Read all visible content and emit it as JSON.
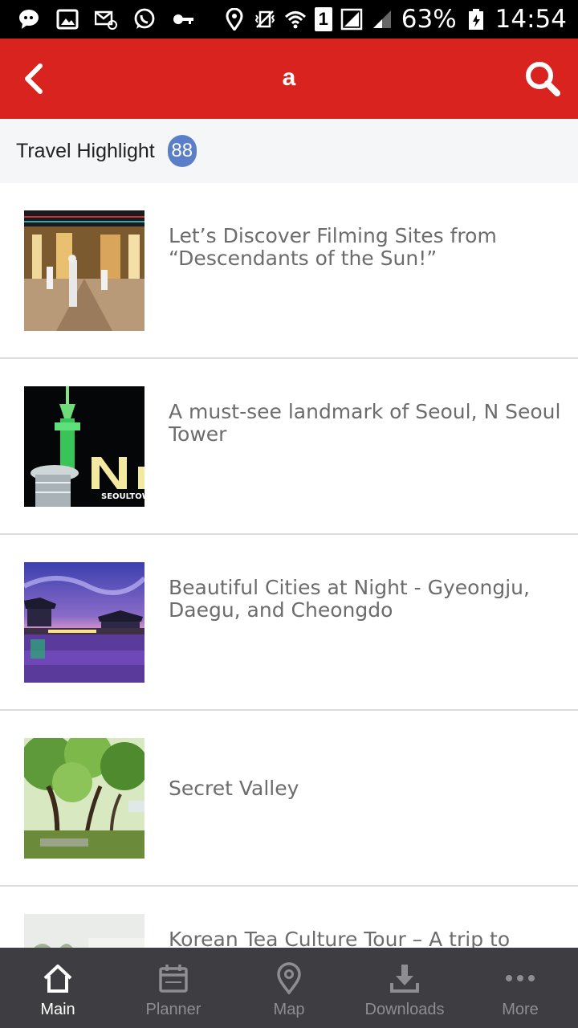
{
  "status_bar": {
    "icons": [
      "chat-bubble-icon",
      "image-icon",
      "mail-icon",
      "whatsapp-icon",
      "key-icon",
      "location-icon",
      "vibrate-icon",
      "wifi-icon",
      "sim-1-icon",
      "signal-icon",
      "signal-2-icon",
      "battery-icon"
    ],
    "sim_label": "1",
    "battery": "63%",
    "time": "14:54"
  },
  "app_bar": {
    "title": "a",
    "back_icon": "chevron-left-icon",
    "search_icon": "search-icon",
    "background": "#d9231f"
  },
  "section": {
    "title": "Travel Highlight",
    "count": "88",
    "badge_color": "#5b7ec9"
  },
  "items": [
    {
      "title": "Let’s Discover Filming Sites from “Descendants of the Sun!”"
    },
    {
      "title": "A must-see landmark of Seoul, N Seoul Tower",
      "thumb_text": "SEOULTOW"
    },
    {
      "title": "Beautiful Cities at Night - Gyeongju, Daegu, and Cheongdo"
    },
    {
      "title": "Secret Valley"
    },
    {
      "title": "Korean Tea Culture Tour – A trip to Hadong"
    }
  ],
  "bottom_nav": [
    {
      "label": "Main",
      "icon": "home-icon",
      "active": true
    },
    {
      "label": "Planner",
      "icon": "calendar-icon",
      "active": false
    },
    {
      "label": "Map",
      "icon": "map-pin-icon",
      "active": false
    },
    {
      "label": "Downloads",
      "icon": "download-icon",
      "active": false
    },
    {
      "label": "More",
      "icon": "more-dots-icon",
      "active": false
    }
  ]
}
